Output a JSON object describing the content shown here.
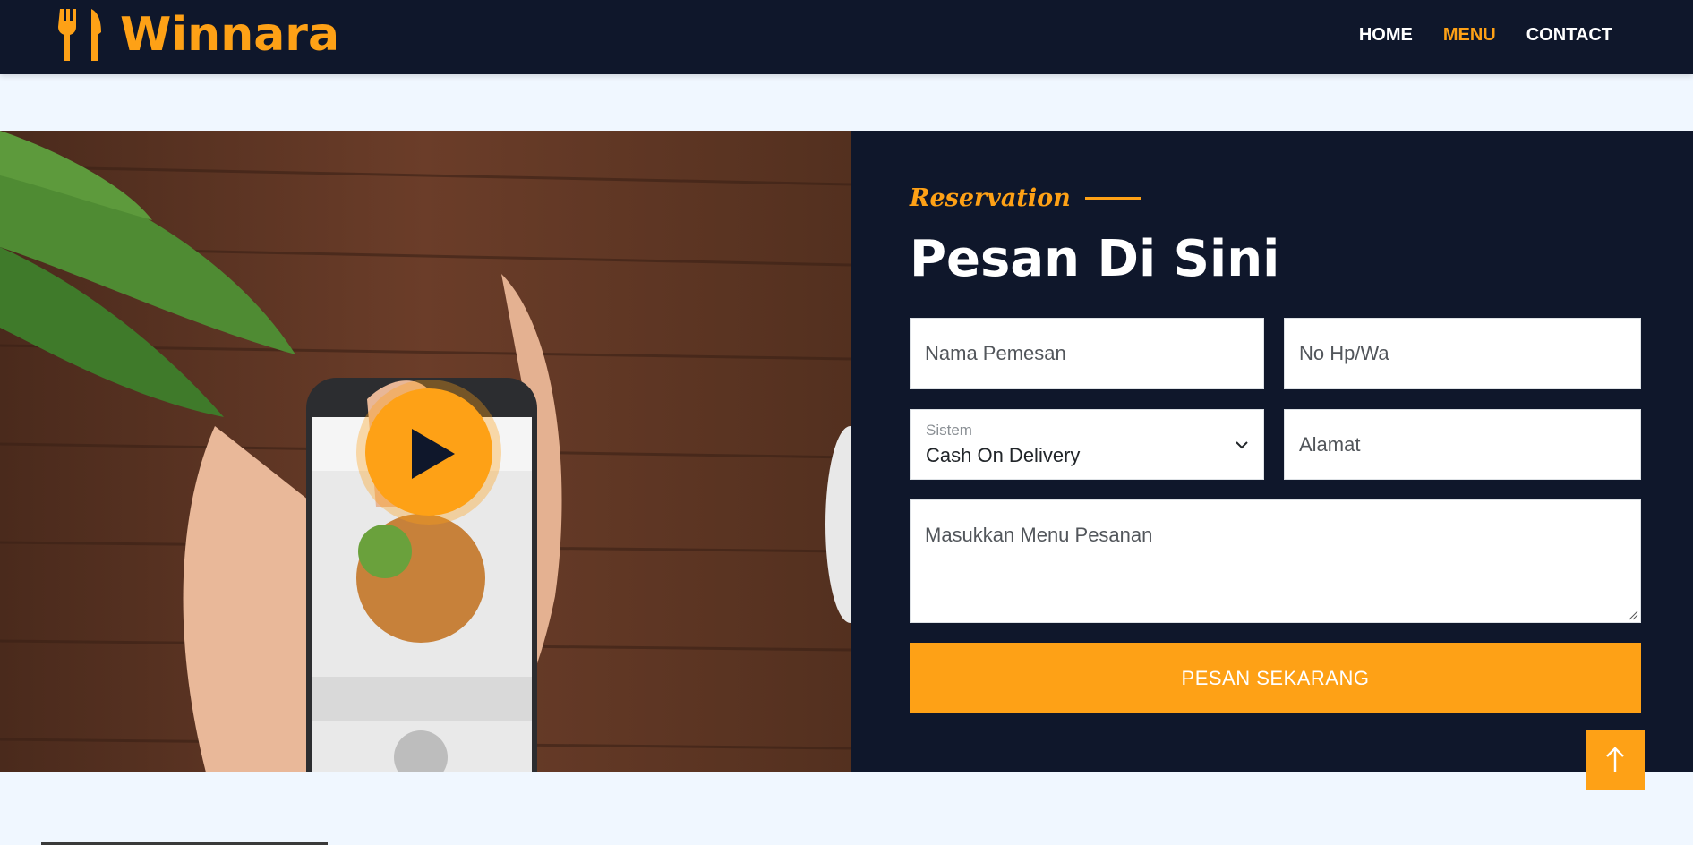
{
  "navbar": {
    "brand": "Winnara",
    "brand_icon": "utensils-icon",
    "items": [
      {
        "label": "Home",
        "active": false
      },
      {
        "label": "Menu",
        "active": true
      },
      {
        "label": "Contact",
        "active": false
      }
    ]
  },
  "video": {
    "play_icon": "play-icon",
    "image": "hands holding smartphone showing online food ordering app on wooden table"
  },
  "reservation": {
    "eyebrow": "Reservation",
    "title": "Pesan Di Sini",
    "name_placeholder": "Nama Pemesan",
    "phone_placeholder": "No Hp/Wa",
    "system_label": "Sistem",
    "system_value": "Cash On Delivery",
    "address_placeholder": "Alamat",
    "menu_placeholder": "Masukkan Menu Pesanan",
    "submit_label": "Pesan Sekarang"
  },
  "back_to_top_icon": "arrow-up-icon",
  "colors": {
    "primary": "#fea116",
    "dark": "#0f172b",
    "light": "#f0f7ff"
  }
}
